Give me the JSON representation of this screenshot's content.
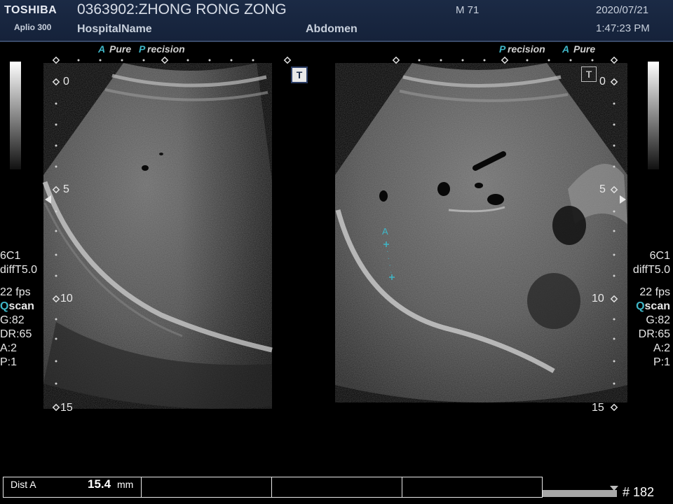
{
  "header": {
    "brand": "TOSHIBA",
    "model": "Aplio 300",
    "patient": "0363902:ZHONG RONG ZONG",
    "hospital": "HospitalName",
    "region": "Abdomen",
    "sex_age": "M 71",
    "date": "2020/07/21",
    "time": "1:47:23 PM"
  },
  "left_panel": {
    "label_a": "A",
    "label_pure": "Pure",
    "label_p": "P",
    "label_precision": "recision",
    "transducer": "6C1",
    "filter": "diffT5.0",
    "fps": "22 fps",
    "qscan_q": "Q",
    "qscan_rest": "scan",
    "gain": "G:82",
    "dr": "DR:65",
    "a": "A:2",
    "p": "P:1",
    "depth_marks": [
      "0",
      "5",
      "10",
      "15"
    ],
    "t_icon": "T"
  },
  "right_panel": {
    "label_precision": "Precision",
    "label_a": "A",
    "label_pure": "Pure",
    "transducer": "6C1",
    "filter": "diffT5.0",
    "fps": "22 fps",
    "qscan_q": "Q",
    "qscan_rest": "scan",
    "gain": "G:82",
    "dr": "DR:65",
    "a": "A:2",
    "p": "P:1",
    "depth_marks": [
      "0",
      "5",
      "10",
      "15"
    ],
    "t_icon": "T",
    "caliper_label": "A"
  },
  "measurement": {
    "label": "Dist A",
    "value": "15.4",
    "unit": "mm"
  },
  "frame": {
    "number": "# 182"
  },
  "colors": {
    "header_bg": "#15223a",
    "accent": "#3fb7c8"
  }
}
